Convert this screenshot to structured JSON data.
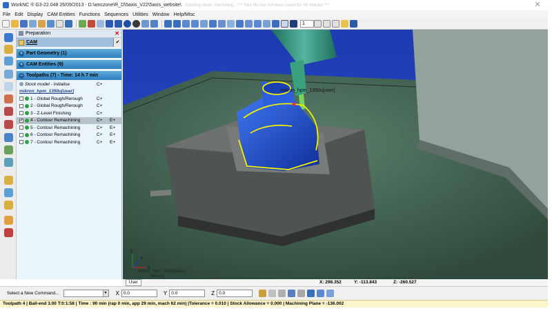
{
  "window": {
    "title": "WorkNC ® G3-22.048   26/09/2013 - D:\\wnczone\\R_D\\5axis_V22\\5axis_website\\",
    "ghost_title": "finishing mode: machining... *** Your file has not been saved for 48 minutes ***",
    "close_glyph": "✕"
  },
  "menu": [
    "File",
    "Edit",
    "Display",
    "CAM Entities",
    "Functions",
    "Sequences",
    "Utilities",
    "Window",
    "Help/Misc"
  ],
  "toolbar": {
    "step_value": "1"
  },
  "panel": {
    "header": "Preparation",
    "close_glyph": "✕",
    "cam_label": "CAM",
    "sections": {
      "part_geometry": "Part Geometry (1)",
      "cam_entities": "CAM Entities (9)",
      "toolpaths": "Toolpaths (7) - Time: 14 h 7 min"
    },
    "stock_model": {
      "name": "Stock model - Initialise",
      "c": "C+"
    },
    "machine": "mikron_hpm_1350u[user]",
    "toolpaths": [
      {
        "name": "1 - Global Rough/Rerough",
        "c": "C+",
        "e": "",
        "checked": false,
        "color": "#2f9e44"
      },
      {
        "name": "2 - Global Rough/Rerough",
        "c": "C+",
        "e": "",
        "checked": false,
        "color": "#2f9e44"
      },
      {
        "name": "3 - Z-Level Finishing",
        "c": "C+",
        "e": "",
        "checked": false,
        "color": "#2f9e44"
      },
      {
        "name": "4 - Contour Remachining",
        "c": "C+",
        "e": "E+",
        "checked": true,
        "color": "#2f9e44"
      },
      {
        "name": "5 - Contour Remachining",
        "c": "C+",
        "e": "E+",
        "checked": false,
        "color": "#2f9e44"
      },
      {
        "name": "6 - Contour Remachining",
        "c": "C+",
        "e": "E+",
        "checked": false,
        "color": "#2f9e44"
      },
      {
        "name": "7 - Contour Remachining",
        "c": "C+",
        "e": "E+",
        "checked": false,
        "color": "#2f9e44"
      }
    ]
  },
  "viewport": {
    "top_label": "mikron_hpm_1350u[user]",
    "bottom_label_1": "mikron_hpm_1350u[user]",
    "bottom_label_2": "Mikron]",
    "axis_x": "X",
    "axis_y": "Y",
    "axis_z": "Z",
    "tab_label": "User",
    "coords": {
      "x": "X: 298.352",
      "y": "Y: -113.843",
      "z": "Z: -260.527"
    }
  },
  "command_bar": {
    "label": "Select a New Command...",
    "x_label": "X",
    "x_value": "0.0",
    "y_label": "Y",
    "y_value": "0.0",
    "z_label": "Z",
    "z_value": "0.0"
  },
  "status": "Toolpath 4 | Ball-end 3.00 T:0:1:58 | Time : 90 min (rap 0 min, app 29 min, mach 62 min) |Tolerance = 0.010 | Stock Allowance = 0.000 | Machining Plane = -136.002",
  "colors": {
    "background_green": "#4a6e5c",
    "vise_gray": "#5b5e5d",
    "part_blue": "#1c4fd8",
    "toolpath_yellow": "#f4f000",
    "spindle_teal": "#2d8f7b",
    "machine_gray": "#8a9893"
  }
}
